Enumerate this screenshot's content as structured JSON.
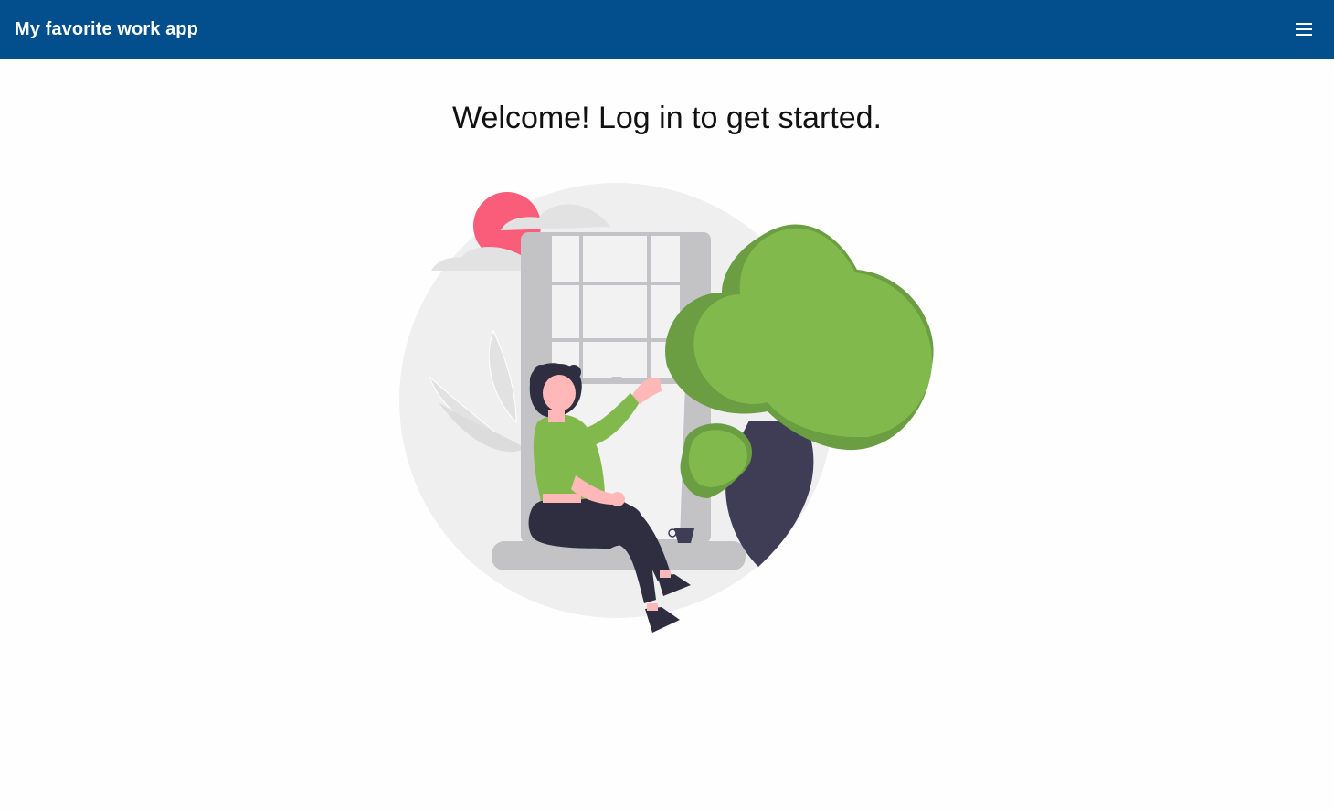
{
  "app_bar": {
    "title": "My favorite work app",
    "menu_icon": "hamburger-menu-icon",
    "background_color": "#034f8d"
  },
  "main": {
    "heading": "Welcome! Log in to get started.",
    "illustration": "woman-sitting-at-window-illustration"
  }
}
